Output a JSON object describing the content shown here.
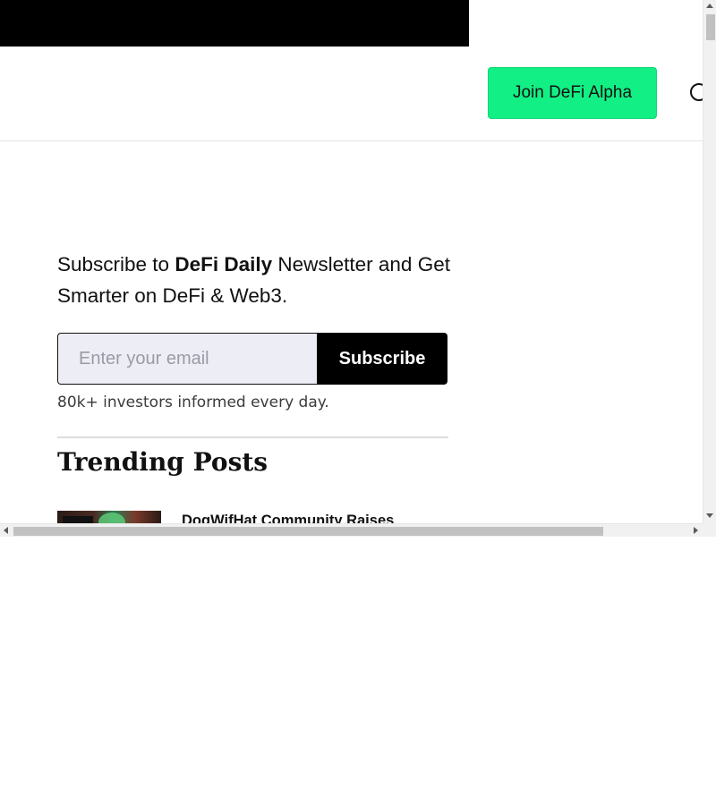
{
  "header": {
    "join_button_label": "Join DeFi Alpha",
    "search_icon": "search-icon"
  },
  "subscribe": {
    "heading_prefix": "Subscribe to ",
    "heading_brand": "DeFi Daily",
    "heading_suffix": " Newsletter and Get Smarter on DeFi & Web3.",
    "email_placeholder": "Enter your email",
    "email_value": "",
    "button_label": "Subscribe",
    "investors_note": "80k+ investors informed every day."
  },
  "trending": {
    "title": "Trending Posts",
    "posts": [
      {
        "title": "DogWifHat Community Raises"
      }
    ]
  },
  "colors": {
    "accent": "#12ef85",
    "banner": "#000000",
    "input_bg": "#edeef5"
  }
}
